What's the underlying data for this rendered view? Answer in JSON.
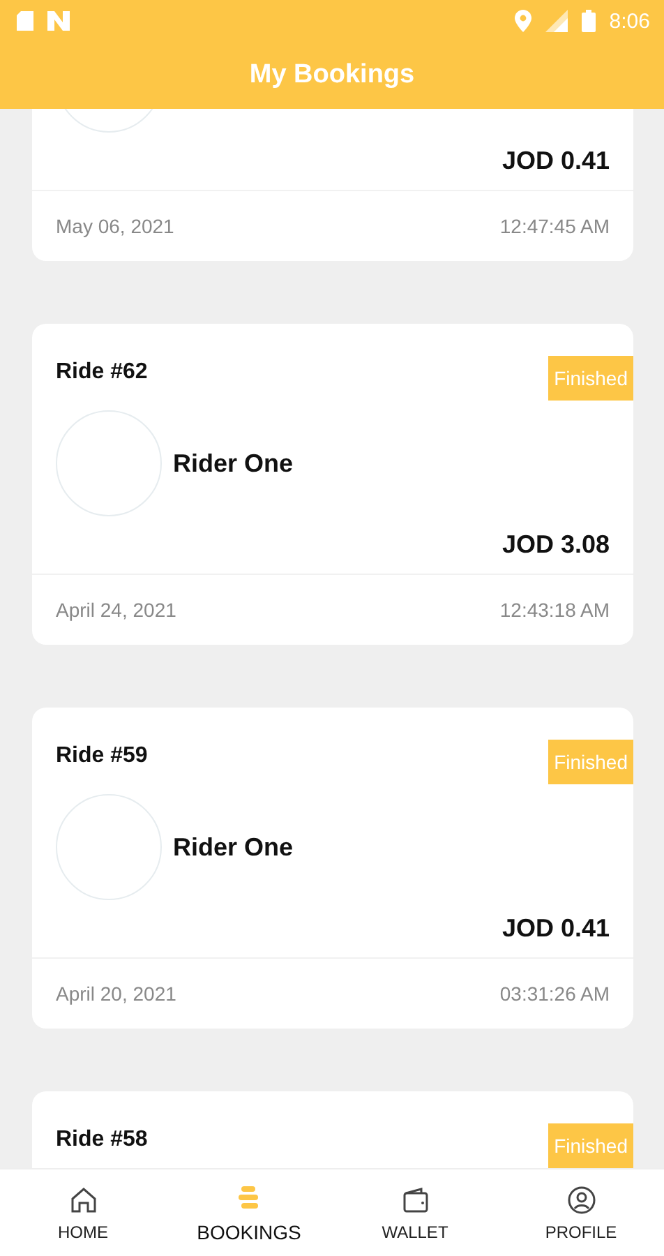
{
  "status_bar": {
    "time": "8:06"
  },
  "app_bar": {
    "title": "My Bookings"
  },
  "bookings": [
    {
      "amount": "JOD 0.41",
      "date": "May 06, 2021",
      "time": "12:47:45 AM"
    },
    {
      "ride": "Ride #62",
      "status": "Finished",
      "rider": "Rider One",
      "amount": "JOD 3.08",
      "date": "April 24, 2021",
      "time": "12:43:18 AM"
    },
    {
      "ride": "Ride #59",
      "status": "Finished",
      "rider": "Rider One",
      "amount": "JOD 0.41",
      "date": "April 20, 2021",
      "time": "03:31:26 AM"
    },
    {
      "ride": "Ride #58",
      "status": "Finished"
    }
  ],
  "nav": [
    {
      "kind": "home",
      "label": "HOME",
      "selected": false
    },
    {
      "kind": "bookings",
      "label": "BOOKINGS",
      "selected": true
    },
    {
      "kind": "wallet",
      "label": "WALLET",
      "selected": false
    },
    {
      "kind": "profile",
      "label": "PROFILE",
      "selected": false
    }
  ]
}
